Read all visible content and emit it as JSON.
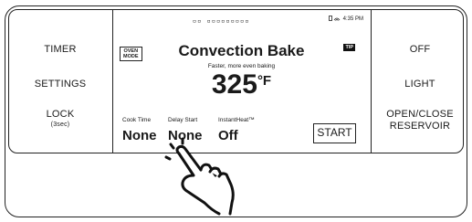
{
  "left_panel": {
    "timer": "TIMER",
    "settings": "SETTINGS",
    "lock": "LOCK",
    "lock_sub": "(3sec)"
  },
  "right_panel": {
    "off": "OFF",
    "light": "LIGHT",
    "open_close_line1": "OPEN/CLOSE",
    "open_close_line2": "RESERVOIR"
  },
  "screen": {
    "indicator_dots": "▫▫ ▫▫▫▫▫▫▫▫▫",
    "status_time": "4:35 PM",
    "mode_badge_line1": "OVEN",
    "mode_badge_line2": "MODE",
    "tip_badge": "TIP",
    "title": "Convection Bake",
    "subtitle": "Faster, more even baking",
    "temperature": "325",
    "temperature_unit": "°F",
    "cook_time_label": "Cook Time",
    "cook_time_value": "None",
    "delay_start_label": "Delay Start",
    "delay_start_value": "None",
    "instant_heat_label": "InstantHeat™",
    "instant_heat_value": "Off",
    "start_button": "START"
  }
}
